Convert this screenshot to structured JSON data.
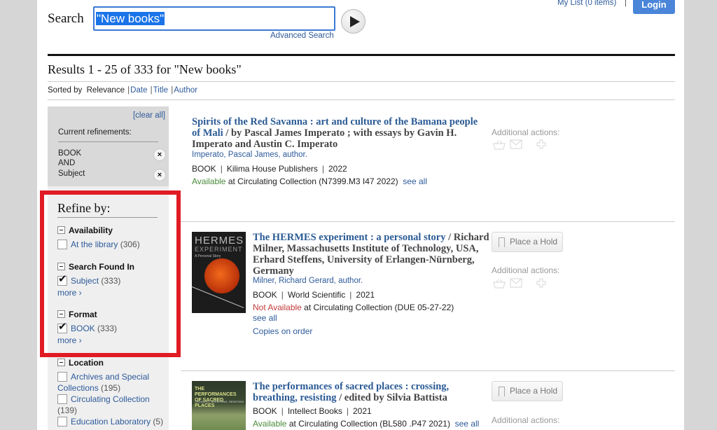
{
  "header": {
    "search_label": "Search",
    "search_value": "\"New books\"",
    "advanced_search": "Advanced Search",
    "my_list": "My List (0 items)",
    "separator": "|",
    "login": "Login"
  },
  "results_header": {
    "heading": "Results 1 - 25 of 333 for \"New books\"",
    "sorted_by_label": "Sorted by",
    "sort_current": "Relevance",
    "sort_options": [
      "Date",
      "Title",
      "Author"
    ]
  },
  "current_refinements": {
    "clear_all": "[clear all]",
    "label": "Current refinements:",
    "items": [
      {
        "text": "BOOK\nAND"
      },
      {
        "text": "Subject"
      }
    ],
    "item1_line1": "BOOK",
    "item1_line2": "AND",
    "item2": "Subject"
  },
  "refine": {
    "title": "Refine by:",
    "facets": [
      {
        "name": "Availability",
        "options": [
          {
            "label": "At the library",
            "count": "(306)",
            "checked": false
          }
        ]
      },
      {
        "name": "Search Found In",
        "options": [
          {
            "label": "Subject",
            "count": "(333)",
            "checked": true
          }
        ],
        "more": "more  ›"
      },
      {
        "name": "Format",
        "options": [
          {
            "label": "BOOK",
            "count": "(333)",
            "checked": true
          }
        ],
        "more": "more  ›"
      },
      {
        "name": "Location",
        "options": [
          {
            "label": "Archives and Special Collections",
            "count": "(195)",
            "checked": false
          },
          {
            "label": "Circulating Collection",
            "count": "(139)",
            "checked": false
          },
          {
            "label": "Education Laboratory",
            "count": "(5)",
            "checked": false
          }
        ]
      }
    ]
  },
  "results": [
    {
      "title_link": "Spirits of the Red Savanna : art and culture of the Bamana people of Mali",
      "title_rest": " / by Pascal James Imperato ; with essays by Gavin H. Imperato and Austin C. Imperato",
      "author": "Imperato, Pascal James, author.",
      "format": "BOOK",
      "publisher": "Kilima House Publishers",
      "year": "2022",
      "availability": "Available",
      "location": " at Circulating Collection (N7399.M3 I47 2022)",
      "see_all": "see all",
      "actions_label": "Additional actions:"
    },
    {
      "title_link": "The HERMES experiment : a personal story",
      "title_rest": " / Richard Milner, Massachusetts Institute of Technology, USA, Erhard Steffens, University of Erlangen-Nürnberg, Germany",
      "author": "Milner, Richard Gerard, author.",
      "format": "BOOK",
      "publisher": "World Scientific",
      "year": "2021",
      "availability": "Not Available",
      "location": " at Circulating Collection (DUE 05-27-22)",
      "see_all": "see all",
      "extra": "Copies on order",
      "hold": "Place a Hold",
      "actions_label": "Additional actions:",
      "cover_title": "HERMES",
      "cover_sub": "EXPERIMENT",
      "cover_tag": "A Personal Story"
    },
    {
      "title_link": "The performances of sacred places : crossing, breathing, resisting",
      "title_rest": " / edited by Silvia Battista",
      "format": "BOOK",
      "publisher": "Intellect Books",
      "year": "2021",
      "availability": "Available",
      "location": " at Circulating Collection (BL580 .P47 2021)",
      "see_all": "see all",
      "hold": "Place a Hold",
      "actions_label": "Additional actions:",
      "cover_title": "THE PERFORMANCES OF SACRED PLACES",
      "cover_sub": "CROSSING, BREATHING, RESISTING"
    }
  ]
}
